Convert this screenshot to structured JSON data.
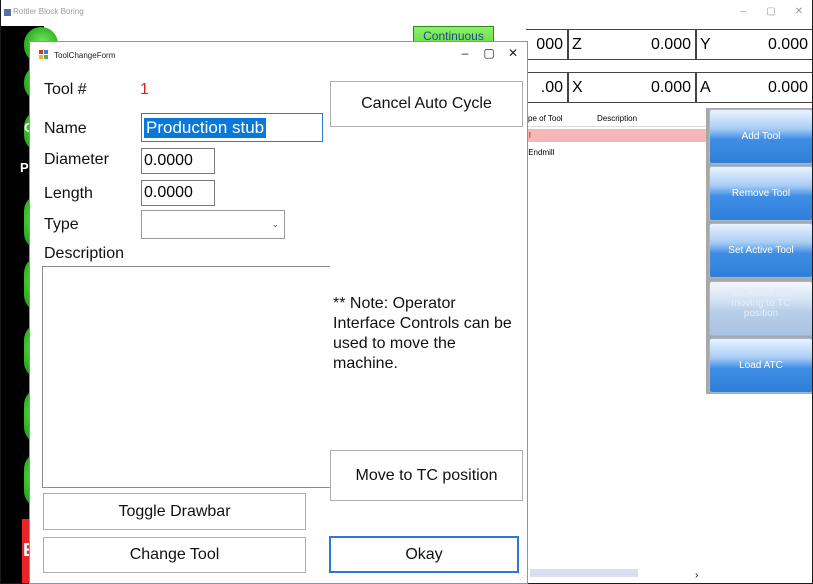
{
  "main_window": {
    "title": "Rottler Block Boring",
    "controls": {
      "minimize": "–",
      "maximize": "▢",
      "close": "✕"
    },
    "continuous_label": "Continuous",
    "strip_letters": [
      "C",
      "P",
      "E"
    ],
    "dro": [
      {
        "value": "000",
        "label": "Z"
      },
      {
        "value": "0.000",
        "label": "Y"
      },
      {
        "value": "0.000",
        "label": ""
      },
      {
        "value": ".00",
        "label": "X"
      },
      {
        "value": "0.000",
        "label": "A"
      },
      {
        "value": "0.000",
        "label": ""
      }
    ],
    "tool_grid": {
      "headers": [
        "pe of Tool",
        "Description"
      ],
      "rows": [
        {
          "type": "l",
          "description": ""
        },
        {
          "type": ":Endmill",
          "description": ""
        }
      ],
      "scroll_arrow": "›"
    },
    "side_buttons": [
      {
        "label": "Add Tool",
        "enabled": true
      },
      {
        "label": "Remove Tool",
        "enabled": true
      },
      {
        "label": "Set Active Tool",
        "enabled": true
      },
      {
        "label": "Set Active w/o moving to TC position",
        "enabled": false
      },
      {
        "label": "Load ATC",
        "enabled": true
      }
    ]
  },
  "dialog": {
    "title": "ToolChangeForm",
    "controls": {
      "minimize": "–",
      "maximize": "▢",
      "close": "✕"
    },
    "tool_label": "Tool #",
    "tool_number": "1",
    "name_label": "Name",
    "name_value": "Production stub",
    "diameter_label": "Diameter",
    "diameter_value": "0.0000",
    "length_label": "Length",
    "length_value": "0.0000",
    "type_label": "Type",
    "type_value": "",
    "description_label": "Description",
    "description_value": "",
    "note": "** Note: Operator Interface Controls can be used to move the machine.",
    "buttons": {
      "cancel_auto_cycle": "Cancel Auto Cycle",
      "move_to_tc": "Move to TC position",
      "toggle_drawbar": "Toggle Drawbar",
      "change_tool": "Change Tool",
      "okay": "Okay"
    }
  }
}
